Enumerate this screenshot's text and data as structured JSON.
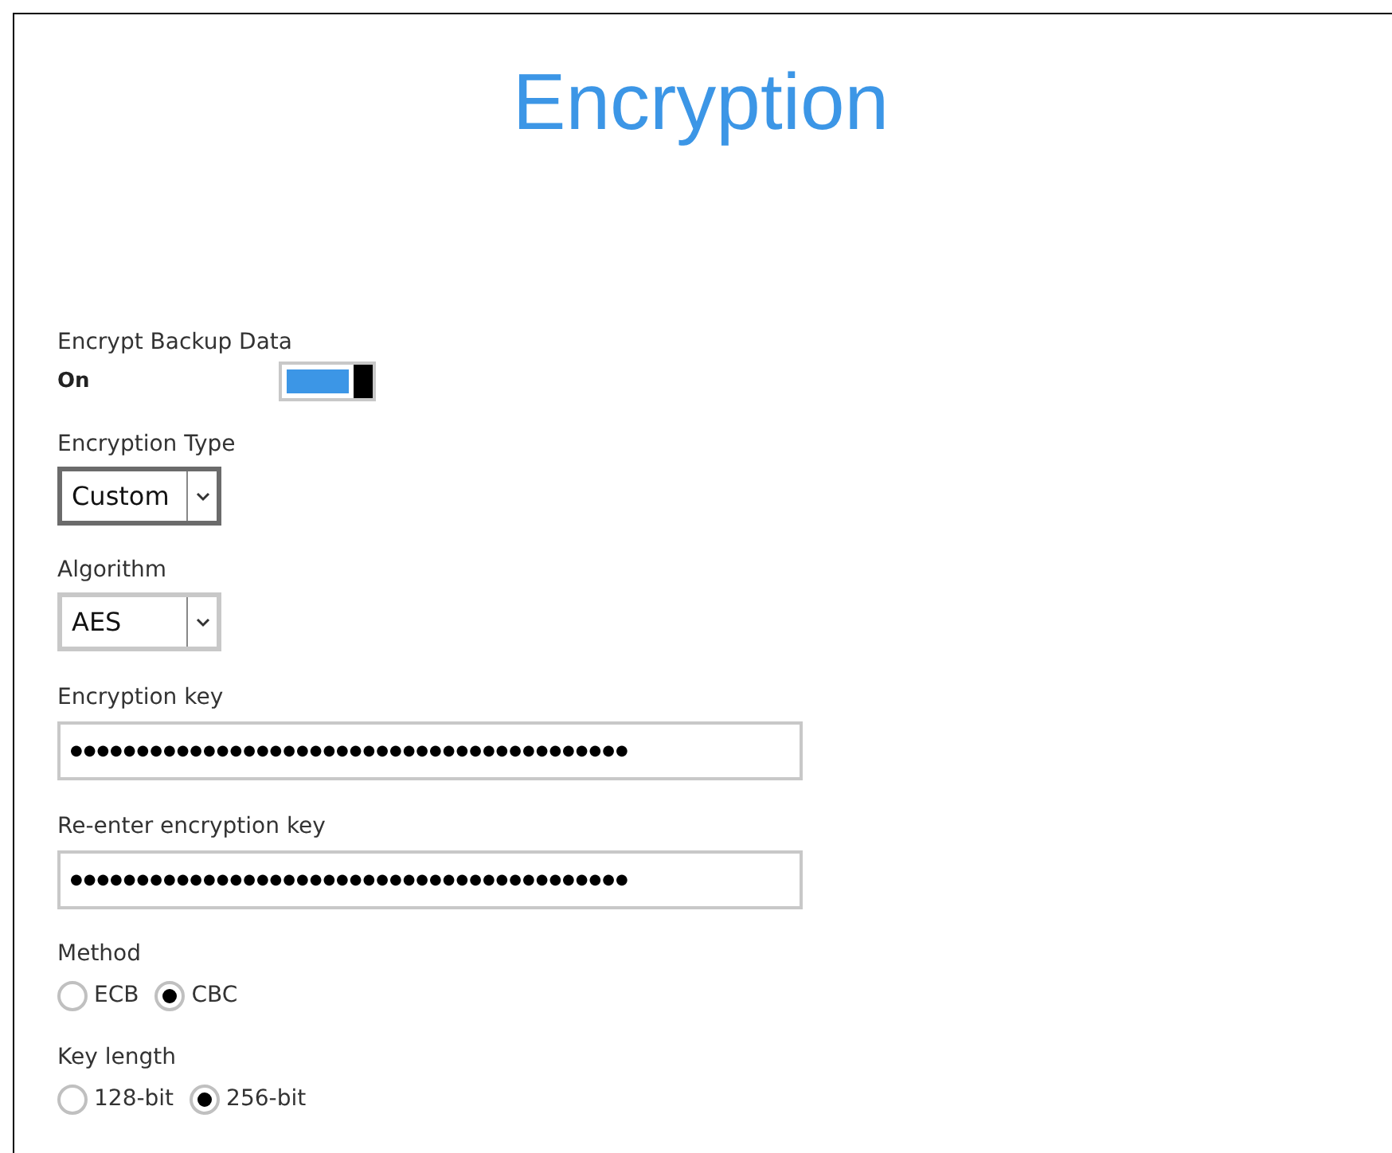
{
  "title": "Encryption",
  "encrypt_backup": {
    "label": "Encrypt Backup Data",
    "state_text": "On",
    "on": true
  },
  "encryption_type": {
    "label": "Encryption Type",
    "value": "Custom",
    "focused": true
  },
  "algorithm": {
    "label": "Algorithm",
    "value": "AES",
    "focused": false
  },
  "key_fields": [
    {
      "label": "Encryption key",
      "value": "●●●●●●●●●●●●●●●●●●●●●●●●●●●●●●●●●●●●●●●●●●"
    },
    {
      "label": "Re-enter encryption key",
      "value": "●●●●●●●●●●●●●●●●●●●●●●●●●●●●●●●●●●●●●●●●●●"
    }
  ],
  "radio_groups": [
    {
      "label": "Method",
      "options": [
        {
          "label": "ECB",
          "selected": false
        },
        {
          "label": "CBC",
          "selected": true
        }
      ]
    },
    {
      "label": "Key length",
      "options": [
        {
          "label": "128-bit",
          "selected": false
        },
        {
          "label": "256-bit",
          "selected": true
        }
      ]
    }
  ]
}
